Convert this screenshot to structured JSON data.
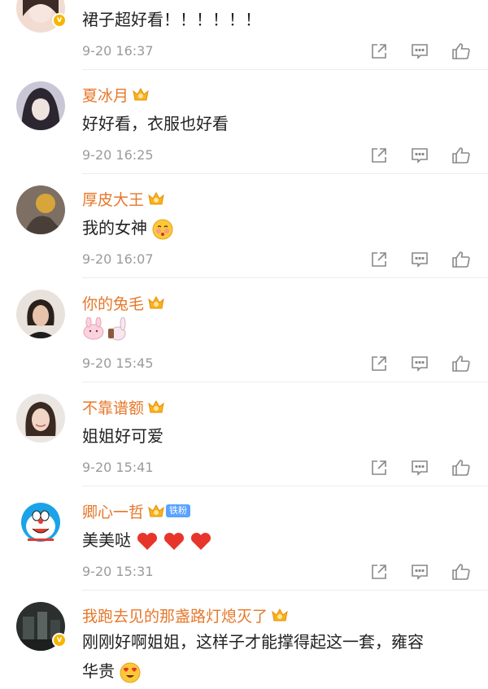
{
  "comments": [
    {
      "username": "",
      "text": "裙子超好看！！！！！！",
      "time": "9-20 16:37",
      "verified": true,
      "avatar": "avatar-girl-light"
    },
    {
      "username": "夏冰月",
      "text": "好好看，衣服也好看",
      "time": "9-20 16:25",
      "avatar": "avatar-anime-girl"
    },
    {
      "username": "厚皮大王",
      "text": "我的女神",
      "emoji": "blush-kiss-emoji",
      "time": "9-20 16:07",
      "avatar": "avatar-leaf"
    },
    {
      "username": "你的兔毛",
      "text": "",
      "emoji": "rabbit-emoji",
      "time": "9-20 15:45",
      "avatar": "avatar-woman-short-hair"
    },
    {
      "username": "不靠谱额",
      "text": "姐姐好可爱",
      "time": "9-20 15:41",
      "avatar": "avatar-woman-smile"
    },
    {
      "username": "卿心一哲",
      "fan_tag": "铁粉",
      "text": "美美哒",
      "emoji": "heart-emoji x3",
      "time": "9-20 15:31",
      "avatar": "avatar-doraemon"
    },
    {
      "username": "我跑去见的那盏路灯熄灭了",
      "text_line1": "刚刚好啊姐姐，这样子才能撑得起这一套，雍容",
      "text_line2": "华贵",
      "emoji": "heart-eyes-emoji",
      "verified": true,
      "avatar": "avatar-dark-scene"
    }
  ],
  "colors": {
    "username": "#e6772a",
    "time": "#9b9b9b",
    "text": "#222222",
    "icon": "#888888"
  },
  "icons": {
    "share": "share-icon",
    "comment": "comment-icon",
    "like": "like-icon",
    "crown": "crown-badge-icon",
    "verified": "verified-badge-icon"
  }
}
